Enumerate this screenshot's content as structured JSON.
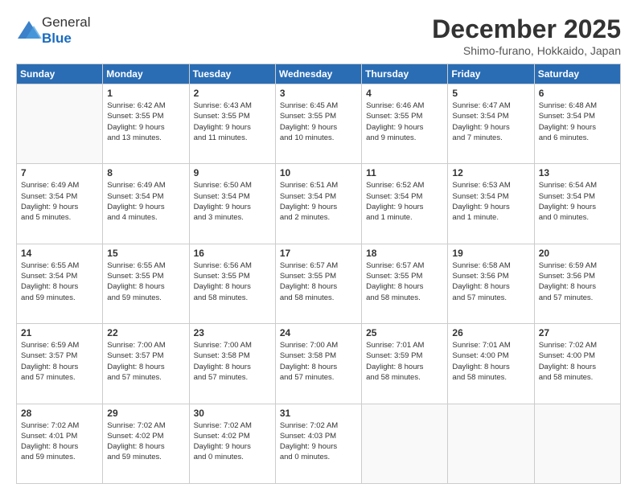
{
  "header": {
    "logo_general": "General",
    "logo_blue": "Blue",
    "month_title": "December 2025",
    "location": "Shimo-furano, Hokkaido, Japan"
  },
  "weekdays": [
    "Sunday",
    "Monday",
    "Tuesday",
    "Wednesday",
    "Thursday",
    "Friday",
    "Saturday"
  ],
  "weeks": [
    [
      {
        "day": "",
        "info": ""
      },
      {
        "day": "1",
        "info": "Sunrise: 6:42 AM\nSunset: 3:55 PM\nDaylight: 9 hours\nand 13 minutes."
      },
      {
        "day": "2",
        "info": "Sunrise: 6:43 AM\nSunset: 3:55 PM\nDaylight: 9 hours\nand 11 minutes."
      },
      {
        "day": "3",
        "info": "Sunrise: 6:45 AM\nSunset: 3:55 PM\nDaylight: 9 hours\nand 10 minutes."
      },
      {
        "day": "4",
        "info": "Sunrise: 6:46 AM\nSunset: 3:55 PM\nDaylight: 9 hours\nand 9 minutes."
      },
      {
        "day": "5",
        "info": "Sunrise: 6:47 AM\nSunset: 3:54 PM\nDaylight: 9 hours\nand 7 minutes."
      },
      {
        "day": "6",
        "info": "Sunrise: 6:48 AM\nSunset: 3:54 PM\nDaylight: 9 hours\nand 6 minutes."
      }
    ],
    [
      {
        "day": "7",
        "info": "Sunrise: 6:49 AM\nSunset: 3:54 PM\nDaylight: 9 hours\nand 5 minutes."
      },
      {
        "day": "8",
        "info": "Sunrise: 6:49 AM\nSunset: 3:54 PM\nDaylight: 9 hours\nand 4 minutes."
      },
      {
        "day": "9",
        "info": "Sunrise: 6:50 AM\nSunset: 3:54 PM\nDaylight: 9 hours\nand 3 minutes."
      },
      {
        "day": "10",
        "info": "Sunrise: 6:51 AM\nSunset: 3:54 PM\nDaylight: 9 hours\nand 2 minutes."
      },
      {
        "day": "11",
        "info": "Sunrise: 6:52 AM\nSunset: 3:54 PM\nDaylight: 9 hours\nand 1 minute."
      },
      {
        "day": "12",
        "info": "Sunrise: 6:53 AM\nSunset: 3:54 PM\nDaylight: 9 hours\nand 1 minute."
      },
      {
        "day": "13",
        "info": "Sunrise: 6:54 AM\nSunset: 3:54 PM\nDaylight: 9 hours\nand 0 minutes."
      }
    ],
    [
      {
        "day": "14",
        "info": "Sunrise: 6:55 AM\nSunset: 3:54 PM\nDaylight: 8 hours\nand 59 minutes."
      },
      {
        "day": "15",
        "info": "Sunrise: 6:55 AM\nSunset: 3:55 PM\nDaylight: 8 hours\nand 59 minutes."
      },
      {
        "day": "16",
        "info": "Sunrise: 6:56 AM\nSunset: 3:55 PM\nDaylight: 8 hours\nand 58 minutes."
      },
      {
        "day": "17",
        "info": "Sunrise: 6:57 AM\nSunset: 3:55 PM\nDaylight: 8 hours\nand 58 minutes."
      },
      {
        "day": "18",
        "info": "Sunrise: 6:57 AM\nSunset: 3:55 PM\nDaylight: 8 hours\nand 58 minutes."
      },
      {
        "day": "19",
        "info": "Sunrise: 6:58 AM\nSunset: 3:56 PM\nDaylight: 8 hours\nand 57 minutes."
      },
      {
        "day": "20",
        "info": "Sunrise: 6:59 AM\nSunset: 3:56 PM\nDaylight: 8 hours\nand 57 minutes."
      }
    ],
    [
      {
        "day": "21",
        "info": "Sunrise: 6:59 AM\nSunset: 3:57 PM\nDaylight: 8 hours\nand 57 minutes."
      },
      {
        "day": "22",
        "info": "Sunrise: 7:00 AM\nSunset: 3:57 PM\nDaylight: 8 hours\nand 57 minutes."
      },
      {
        "day": "23",
        "info": "Sunrise: 7:00 AM\nSunset: 3:58 PM\nDaylight: 8 hours\nand 57 minutes."
      },
      {
        "day": "24",
        "info": "Sunrise: 7:00 AM\nSunset: 3:58 PM\nDaylight: 8 hours\nand 57 minutes."
      },
      {
        "day": "25",
        "info": "Sunrise: 7:01 AM\nSunset: 3:59 PM\nDaylight: 8 hours\nand 58 minutes."
      },
      {
        "day": "26",
        "info": "Sunrise: 7:01 AM\nSunset: 4:00 PM\nDaylight: 8 hours\nand 58 minutes."
      },
      {
        "day": "27",
        "info": "Sunrise: 7:02 AM\nSunset: 4:00 PM\nDaylight: 8 hours\nand 58 minutes."
      }
    ],
    [
      {
        "day": "28",
        "info": "Sunrise: 7:02 AM\nSunset: 4:01 PM\nDaylight: 8 hours\nand 59 minutes."
      },
      {
        "day": "29",
        "info": "Sunrise: 7:02 AM\nSunset: 4:02 PM\nDaylight: 8 hours\nand 59 minutes."
      },
      {
        "day": "30",
        "info": "Sunrise: 7:02 AM\nSunset: 4:02 PM\nDaylight: 9 hours\nand 0 minutes."
      },
      {
        "day": "31",
        "info": "Sunrise: 7:02 AM\nSunset: 4:03 PM\nDaylight: 9 hours\nand 0 minutes."
      },
      {
        "day": "",
        "info": ""
      },
      {
        "day": "",
        "info": ""
      },
      {
        "day": "",
        "info": ""
      }
    ]
  ]
}
